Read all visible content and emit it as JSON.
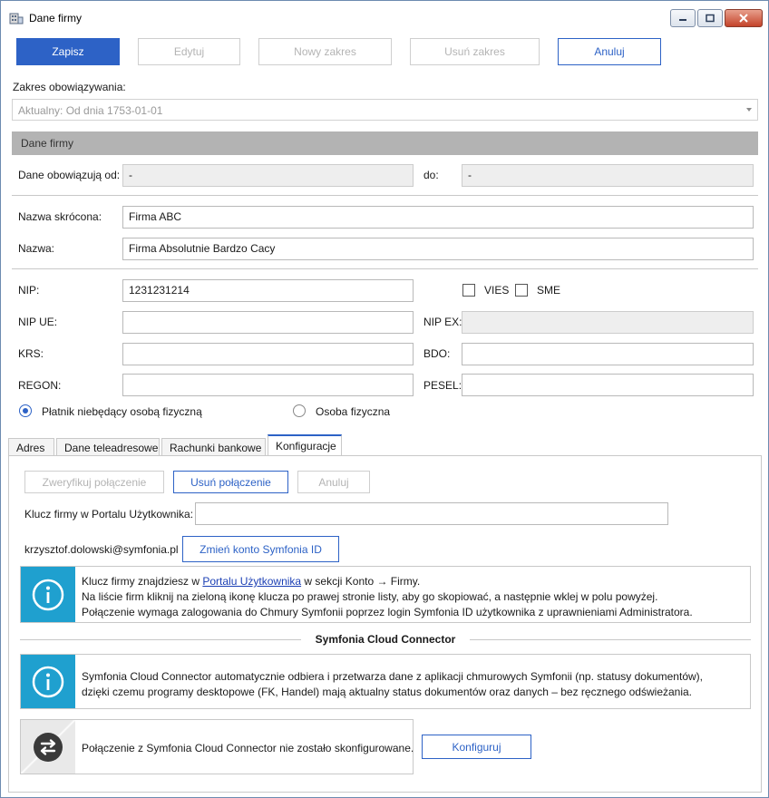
{
  "window": {
    "title": "Dane firmy"
  },
  "toolbar": {
    "save_label": "Zapisz",
    "edit_label": "Edytuj",
    "new_range_label": "Nowy zakres",
    "delete_range_label": "Usuń zakres",
    "cancel_label": "Anuluj"
  },
  "validity": {
    "label": "Zakres obowiązywania:",
    "selected": "Aktualny: Od dnia 1753-01-01"
  },
  "section": {
    "title": "Dane firmy"
  },
  "form": {
    "valid_from_label": "Dane obowiązują od:",
    "valid_from_value": "-",
    "valid_to_label": "do:",
    "valid_to_value": "-",
    "short_name_label": "Nazwa skrócona:",
    "short_name_value": "Firma ABC",
    "name_label": "Nazwa:",
    "name_value": "Firma Absolutnie Bardzo Cacy",
    "nip_label": "NIP:",
    "nip_value": "1231231214",
    "vies_label": "VIES",
    "sme_label": "SME",
    "nip_ue_label": "NIP UE:",
    "nip_ue_value": "",
    "nip_ex_label": "NIP EX:",
    "nip_ex_value": "",
    "krs_label": "KRS:",
    "krs_value": "",
    "bdo_label": "BDO:",
    "bdo_value": "",
    "regon_label": "REGON:",
    "regon_value": "",
    "pesel_label": "PESEL:",
    "pesel_value": "",
    "payer_type_options": [
      "Płatnik niebędący osobą fizyczną",
      "Osoba fizyczna"
    ],
    "payer_type_selected": "Płatnik niebędący osobą fizyczną"
  },
  "tabs": [
    {
      "label": "Adres"
    },
    {
      "label": "Dane teleadresowe"
    },
    {
      "label": "Rachunki bankowe"
    },
    {
      "label": "Konfiguracje"
    }
  ],
  "active_tab": "Konfiguracje",
  "config": {
    "verify_label": "Zweryfikuj połączenie",
    "remove_connection_label": "Usuń połączenie",
    "cancel_label": "Anuluj",
    "key_label": "Klucz firmy w Portalu Użytkownika:",
    "key_value": "",
    "account_email": "krzysztof.dolowski@symfonia.pl",
    "change_account_label": "Zmień konto Symfonia ID",
    "info1_prefix": "Klucz firmy znajdziesz w ",
    "info1_link": "Portalu Użytkownika",
    "info1_suffix": " w sekcji Konto → Firmy.",
    "info1_line2": "Na liście firm kliknij na zieloną ikonę klucza po prawej stronie listy, aby go skopiować, a następnie wklej w polu powyżej.",
    "info1_line3": "Połączenie wymaga zalogowania do Chmury Symfonii poprzez login Symfonia ID użytkownika z uprawnieniami Administratora.",
    "connector_title": "Symfonia Cloud Connector",
    "info2_line1": "Symfonia Cloud Connector automatycznie odbiera i przetwarza dane z aplikacji chmurowych Symfonii (np. statusy dokumentów),",
    "info2_line2": "dzięki czemu programy desktopowe (FK, Handel) mają aktualny status dokumentów oraz danych – bez ręcznego odświeżania.",
    "connector_status": "Połączenie z Symfonia Cloud Connector nie zostało skonfigurowane.",
    "configure_label": "Konfiguruj"
  },
  "colors": {
    "accent": "#2d62c6",
    "info": "#1fa0cf",
    "section_header": "#b3b3b3"
  }
}
